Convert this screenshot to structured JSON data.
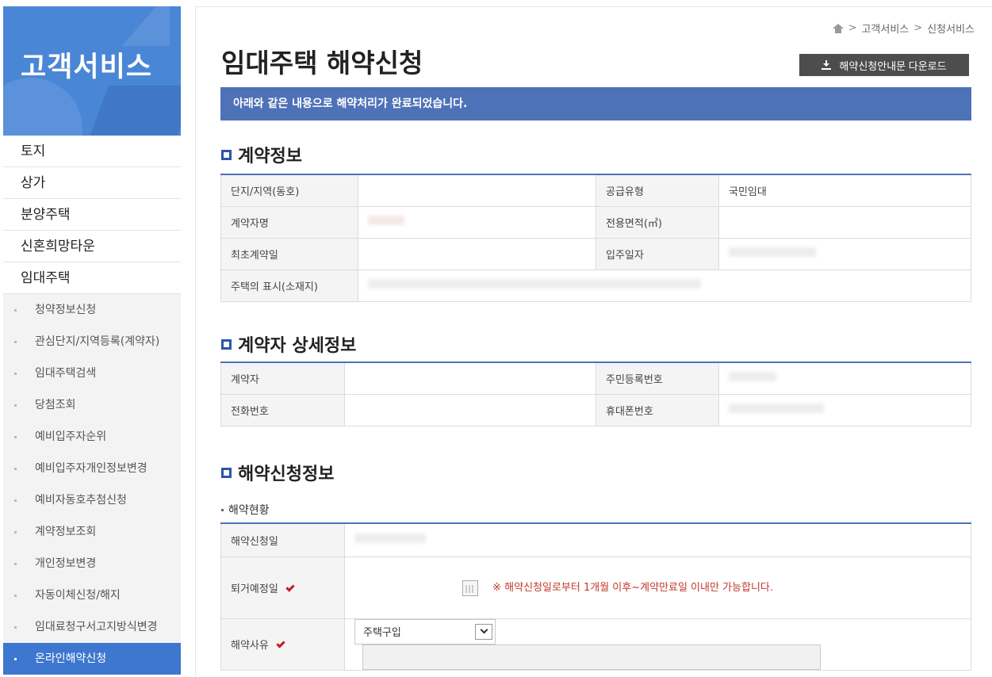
{
  "sidebar": {
    "title": "고객서비스",
    "main_items": [
      {
        "label": "토지"
      },
      {
        "label": "상가"
      },
      {
        "label": "분양주택"
      },
      {
        "label": "신혼희망타운"
      },
      {
        "label": "임대주택"
      }
    ],
    "sub_items": [
      {
        "label": "청약정보신청"
      },
      {
        "label": "관심단지/지역등록(계약자)"
      },
      {
        "label": "임대주택검색"
      },
      {
        "label": "당첨조회"
      },
      {
        "label": "예비입주자순위"
      },
      {
        "label": "예비입주자개인정보변경"
      },
      {
        "label": "예비자동호추첨신청"
      },
      {
        "label": "계약정보조회"
      },
      {
        "label": "개인정보변경"
      },
      {
        "label": "자동이체신청/해지"
      },
      {
        "label": "임대료청구서고지방식변경"
      },
      {
        "label": "온라인해약신청"
      }
    ],
    "active_sub": "온라인해약신청"
  },
  "breadcrumb": {
    "items": [
      "고객서비스",
      "신청서비스"
    ],
    "separator": ">"
  },
  "page": {
    "title": "임대주택 해약신청",
    "download_label": "해약신청안내문 다운로드",
    "notice": "아래와 같은 내용으로 해약처리가 완료되었습니다."
  },
  "contract_info": {
    "title": "계약정보",
    "labels": {
      "complex": "단지/지역(동호)",
      "supply_type": "공급유형",
      "contractor": "계약자명",
      "area": "전용면적(㎡)",
      "first_contract": "최초계약일",
      "move_in": "입주일자",
      "address": "주택의 표시(소재지)"
    },
    "values": {
      "supply_type": "국민임대"
    }
  },
  "contractor_detail": {
    "title": "계약자 상세정보",
    "labels": {
      "contractor": "계약자",
      "rrn": "주민등록번호",
      "phone": "전화번호",
      "mobile": "휴대폰번호"
    }
  },
  "termination": {
    "title": "해약신청정보",
    "subtitle": "해약현황",
    "labels": {
      "apply_date": "해약신청일",
      "moveout_date": "퇴거예정일",
      "reason": "해약사유"
    },
    "warning": "※ 해약신청일로부터 1개월 이후~계약만료일 이내만 가능합니다.",
    "reason_selected": "주택구입"
  },
  "colors": {
    "sidebar_banner": "#4a86d6",
    "active_menu": "#3e77cf",
    "notice_bar": "#4e72b7",
    "required_check": "#c6191f",
    "warning_text": "#c0392b"
  }
}
